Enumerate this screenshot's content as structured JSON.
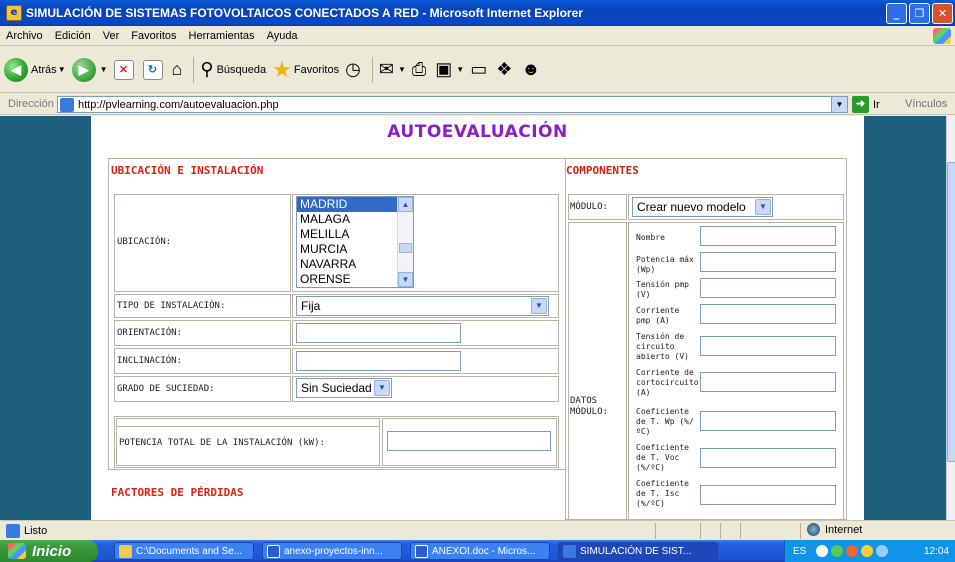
{
  "window": {
    "title": "SIMULACIÓN DE SISTEMAS FOTOVOLTAICOS CONECTADOS A RED - Microsoft Internet Explorer",
    "controls": {
      "minimize": "_",
      "maximize": "❐",
      "close": "✕"
    }
  },
  "menu": [
    "Archivo",
    "Edición",
    "Ver",
    "Favoritos",
    "Herramientas",
    "Ayuda"
  ],
  "toolbar": {
    "back_label": "Atrás",
    "search_label": "Búsqueda",
    "favorites_label": "Favoritos"
  },
  "address": {
    "label": "Dirección",
    "url": "http://pvlearning.com/autoevaluacion.php",
    "go_label": "Ir",
    "links_label": "Vínculos"
  },
  "page": {
    "title": "AUTOEVALUACIÓN",
    "ubicacion_section": "UBICACIÓN E INSTALACIÓN",
    "componentes_section": "COMPONENTES",
    "ubicacion_label": "UBICACIÓN:",
    "locations": [
      "MADRID",
      "MALAGA",
      "MELILLA",
      "MURCIA",
      "NAVARRA",
      "ORENSE"
    ],
    "selected_location": "MADRID",
    "tipo_label": "TIPO DE INSTALACIÓN:",
    "tipo_value": "Fija",
    "orientacion_label": "ORIENTACIÓN:",
    "orientacion_value": "",
    "inclinacion_label": "INCLINACIÓN:",
    "inclinacion_value": "",
    "suciedad_label": "GRADO DE SUCIEDAD:",
    "suciedad_value": "Sin Suciedad",
    "potencia_label": "POTENCIA TOTAL DE LA INSTALACIÓN (kW):",
    "potencia_value": "",
    "perdidas_section": "FACTORES DE PÉRDIDAS",
    "modulo_label": "MÓDULO:",
    "modulo_value": "Crear nuevo modelo",
    "datos_modulo_label": "DATOS MÓDULO:",
    "module_fields": [
      "Nombre",
      "Potencia máx (Wp)",
      "Tensión pmp (V)",
      "Corriente pmp (A)",
      "Tensión de circuito abierto (V)",
      "Corriente de cortocircuito (A)",
      "Coeficiente de T. Wp (%/ºC)",
      "Coeficiente de T. Voc (%/ºC)",
      "Coeficiente de T. Isc (%/ºC)"
    ]
  },
  "status": {
    "text": "Listo",
    "zone": "Internet"
  },
  "taskbar": {
    "start_label": "Inicio",
    "tasks": [
      "C:\\Documents and Se...",
      "anexo-proyectos-inn...",
      "ANEXOI.doc - Micros...",
      "SIMULACIÓN DE SIST..."
    ],
    "lang": "ES",
    "clock": "12:04"
  }
}
